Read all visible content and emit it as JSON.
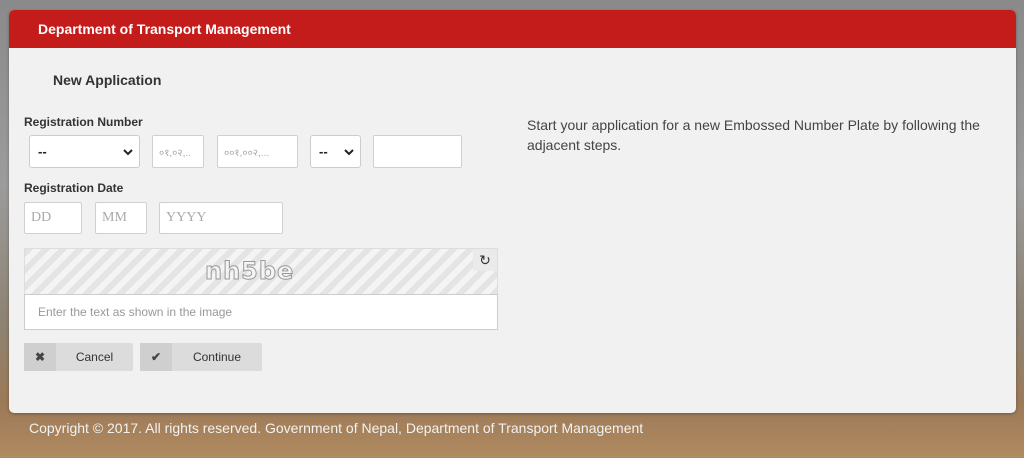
{
  "header": {
    "title": "Department of Transport Management"
  },
  "form": {
    "section_title": "New Application",
    "registration_number_label": "Registration Number",
    "reg_select_1": "--",
    "reg_field_2_placeholder": "०१,०२,..",
    "reg_field_3_placeholder": "००१,००२,...",
    "reg_select_4": "--",
    "reg_field_5_value": "",
    "registration_date_label": "Registration Date",
    "day_placeholder": "DD",
    "month_placeholder": "MM",
    "year_placeholder": "YYYY",
    "captcha_text": "nh5be",
    "captcha_placeholder": "Enter the text as shown in the image",
    "cancel_label": "Cancel",
    "continue_label": "Continue"
  },
  "info": {
    "text": "Start your application for a new Embossed Number Plate by following the adjacent steps."
  },
  "footer": {
    "text": "Copyright © 2017. All rights reserved. Government of Nepal, Department of Transport Management"
  },
  "colors": {
    "header_bg": "#c41b1b",
    "card_bg": "#f1f1f1"
  },
  "icons": {
    "select_arrow": "chevron-down-icon",
    "refresh": "refresh-icon",
    "cancel": "close-icon",
    "continue": "check-icon"
  }
}
